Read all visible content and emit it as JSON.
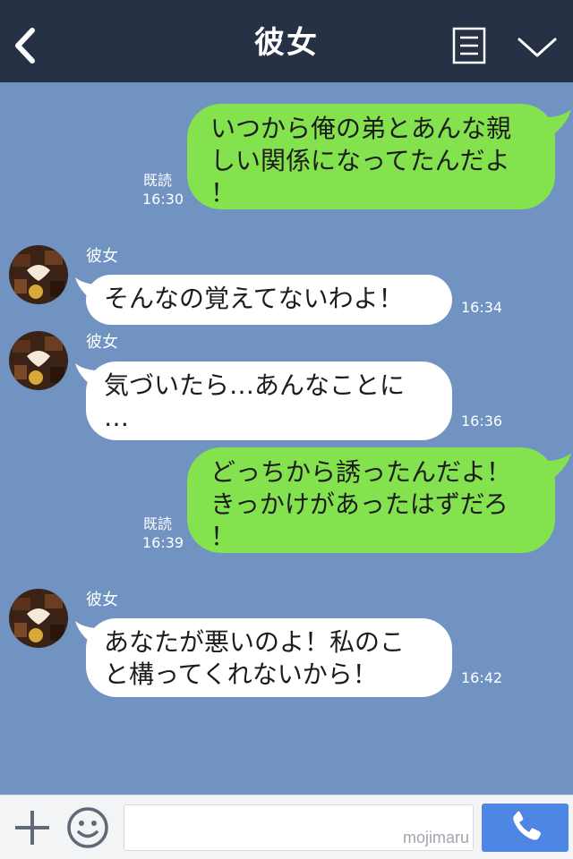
{
  "header": {
    "title": "彼女",
    "icons": {
      "back": "back-arrow-icon",
      "menu": "menu-icon",
      "expand": "chevron-down-icon"
    }
  },
  "colors": {
    "header_bg": "#273146",
    "chat_bg": "#7093c2",
    "sent_bubble": "#84e24e",
    "received_bubble": "#ffffff",
    "call_button": "#4e86e4"
  },
  "messages": [
    {
      "from": "me",
      "text": "いつから俺の弟とあんな親\nしい関係になってたんだよ\n！",
      "read": "既読",
      "time": "16:30"
    },
    {
      "from": "彼女",
      "sender": "彼女",
      "text": "そんなの覚えてないわよ！",
      "time": "16:34"
    },
    {
      "from": "彼女",
      "sender": "彼女",
      "text": "気づいたら…あんなことに\n…",
      "time": "16:36"
    },
    {
      "from": "me",
      "text": "どっちから誘ったんだよ！\nきっかけがあったはずだろ\n！",
      "read": "既読",
      "time": "16:39"
    },
    {
      "from": "彼女",
      "sender": "彼女",
      "text": "あなたが悪いのよ！私のこ\nと構ってくれないから！",
      "time": "16:42"
    }
  ],
  "footer": {
    "input_value": "",
    "watermark": "mojimaru",
    "icons": {
      "add": "plus-icon",
      "sticker": "emoji-icon",
      "call": "phone-icon"
    }
  }
}
